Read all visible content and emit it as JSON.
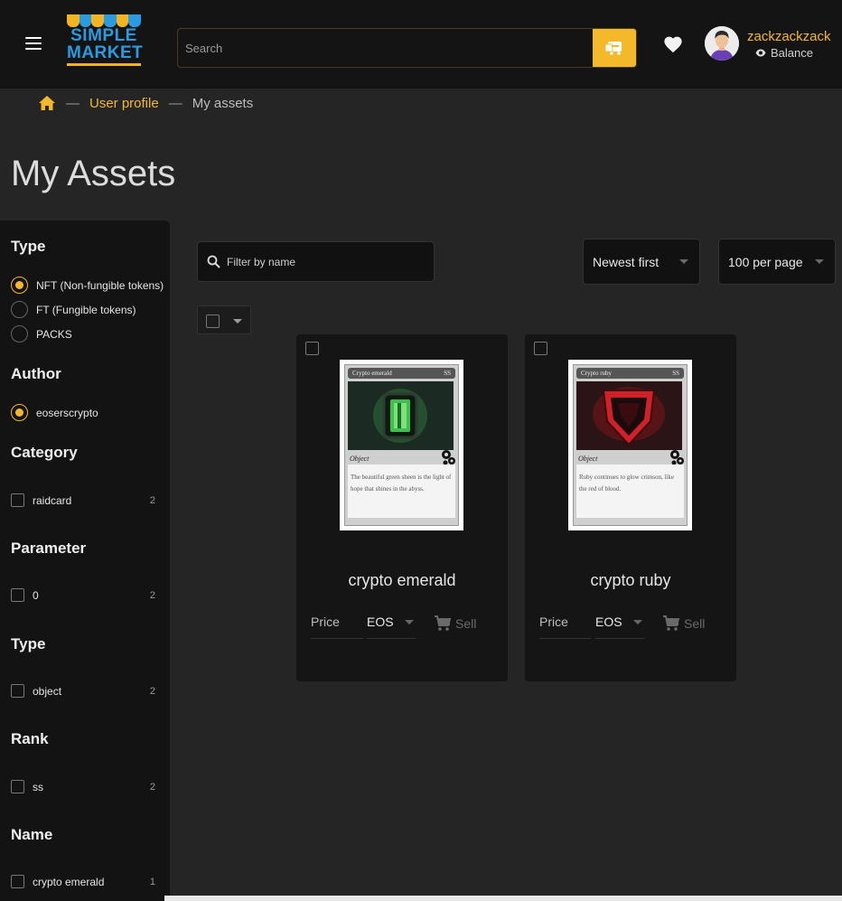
{
  "header": {
    "logo_line1": "SIMPLE",
    "logo_line2": "MARKET",
    "search_placeholder": "Search",
    "username": "zackzackzack",
    "balance_label": "Balance",
    "colors": {
      "accent": "#f4b82b",
      "logo_blue": "#2a9be0"
    }
  },
  "breadcrumb": {
    "separator": "—",
    "items": [
      "User profile",
      "My assets"
    ]
  },
  "page_title": "My Assets",
  "filters": {
    "type": {
      "title": "Type",
      "options": [
        {
          "label": "NFT (Non-fungible tokens)",
          "selected": true
        },
        {
          "label": "FT (Fungible tokens)",
          "selected": false
        },
        {
          "label": "PACKS",
          "selected": false
        }
      ]
    },
    "author": {
      "title": "Author",
      "options": [
        {
          "label": "eoserscrypto",
          "selected": true
        }
      ]
    },
    "category": {
      "title": "Category",
      "items": [
        {
          "label": "raidcard",
          "count": "2"
        }
      ]
    },
    "parameter": {
      "title": "Parameter",
      "items": [
        {
          "label": "0",
          "count": "2"
        }
      ]
    },
    "type2": {
      "title": "Type",
      "items": [
        {
          "label": "object",
          "count": "2"
        }
      ]
    },
    "rank": {
      "title": "Rank",
      "items": [
        {
          "label": "ss",
          "count": "2"
        }
      ]
    },
    "name": {
      "title": "Name",
      "items": [
        {
          "label": "crypto emerald",
          "count": "1"
        }
      ]
    }
  },
  "toolbar": {
    "filter_placeholder": "Filter by name",
    "sort_value": "Newest first",
    "per_page_value": "100 per page"
  },
  "assets": [
    {
      "name": "crypto emerald",
      "card_title": "Crypto emerald",
      "card_rank": "SS",
      "card_type": "Object",
      "card_text": "The beautiful green sheen is the light of hope that shines in the abyss.",
      "price_label": "Price",
      "currency": "EOS",
      "sell_label": "Sell",
      "gem_color": "#3fbf4f"
    },
    {
      "name": "crypto ruby",
      "card_title": "Crypto ruby",
      "card_rank": "SS",
      "card_type": "Object",
      "card_text": "Ruby continues to glow crimson, like the red of blood.",
      "price_label": "Price",
      "currency": "EOS",
      "sell_label": "Sell",
      "gem_color": "#d0202a"
    }
  ]
}
